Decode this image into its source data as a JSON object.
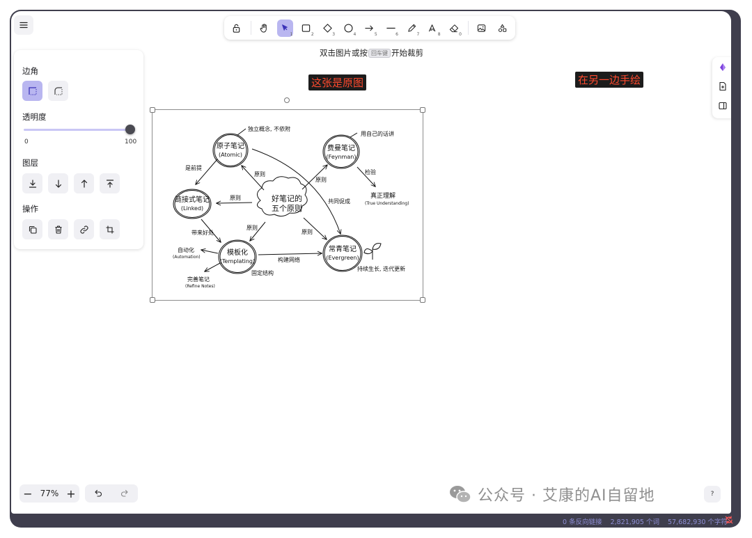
{
  "toolbar": {
    "tools": [
      {
        "name": "lock",
        "sub": ""
      },
      {
        "name": "hand",
        "sub": ""
      },
      {
        "name": "select",
        "sub": "1",
        "active": true
      },
      {
        "name": "rectangle",
        "sub": "2"
      },
      {
        "name": "diamond",
        "sub": "3"
      },
      {
        "name": "ellipse",
        "sub": "4"
      },
      {
        "name": "arrow",
        "sub": "5"
      },
      {
        "name": "line",
        "sub": "6"
      },
      {
        "name": "draw",
        "sub": "7"
      },
      {
        "name": "text",
        "sub": "8"
      },
      {
        "name": "eraser",
        "sub": "0"
      },
      {
        "name": "image",
        "sub": ""
      },
      {
        "name": "library",
        "sub": ""
      }
    ]
  },
  "hint": {
    "before": "双击图片或按",
    "key": "回车键",
    "after": "开始裁剪"
  },
  "panel": {
    "corner_label": "边角",
    "opacity_label": "透明度",
    "opacity_min": "0",
    "opacity_max": "100",
    "opacity_value": 100,
    "layer_label": "图层",
    "actions_label": "操作"
  },
  "labels": {
    "original": "这张是原图",
    "other": "在另一边手绘"
  },
  "sketch": {
    "center": [
      "好笔记的",
      "五个原则"
    ],
    "atomic": [
      "原子笔记",
      "(Atomic)"
    ],
    "feynman": [
      "费曼笔记",
      "(Feynman)"
    ],
    "linked": [
      "链接式笔记",
      "(Linked)"
    ],
    "templating": [
      "模板化",
      "(Templating)"
    ],
    "evergreen": [
      "常青笔记",
      "(Evergreen)"
    ],
    "notes": {
      "independent": "独立概念, 不依附",
      "own_words": "用自己的话讲",
      "prerequisite": "是前提",
      "principle": "原则",
      "verify": "检验",
      "understanding": "真正理解",
      "understanding_en": "(True Understanding)",
      "promote": "共同促成",
      "benefit": "带来好处",
      "automation": "自动化",
      "automation_en": "(Automation)",
      "refine": "完善笔记",
      "refine_en": "(Refine Notes)",
      "network": "构建网络",
      "structure": "固定结构",
      "grow": "持续生长, 迭代更新"
    }
  },
  "zoom": {
    "value": "77%",
    "minus": "−",
    "plus": "+"
  },
  "help": "?",
  "watermark": "公众号 · 艾康的AI自留地",
  "status": {
    "backlinks": "0 条反向链接",
    "words": "2,821,905 个词",
    "chars": "57,682,930 个字符"
  },
  "colors": {
    "accent": "#b9b6f0",
    "frame": "#3f3e4d",
    "label_text": "#ff4a2e",
    "label_bg": "#1c1c1c",
    "status": "#8f8fd6"
  }
}
